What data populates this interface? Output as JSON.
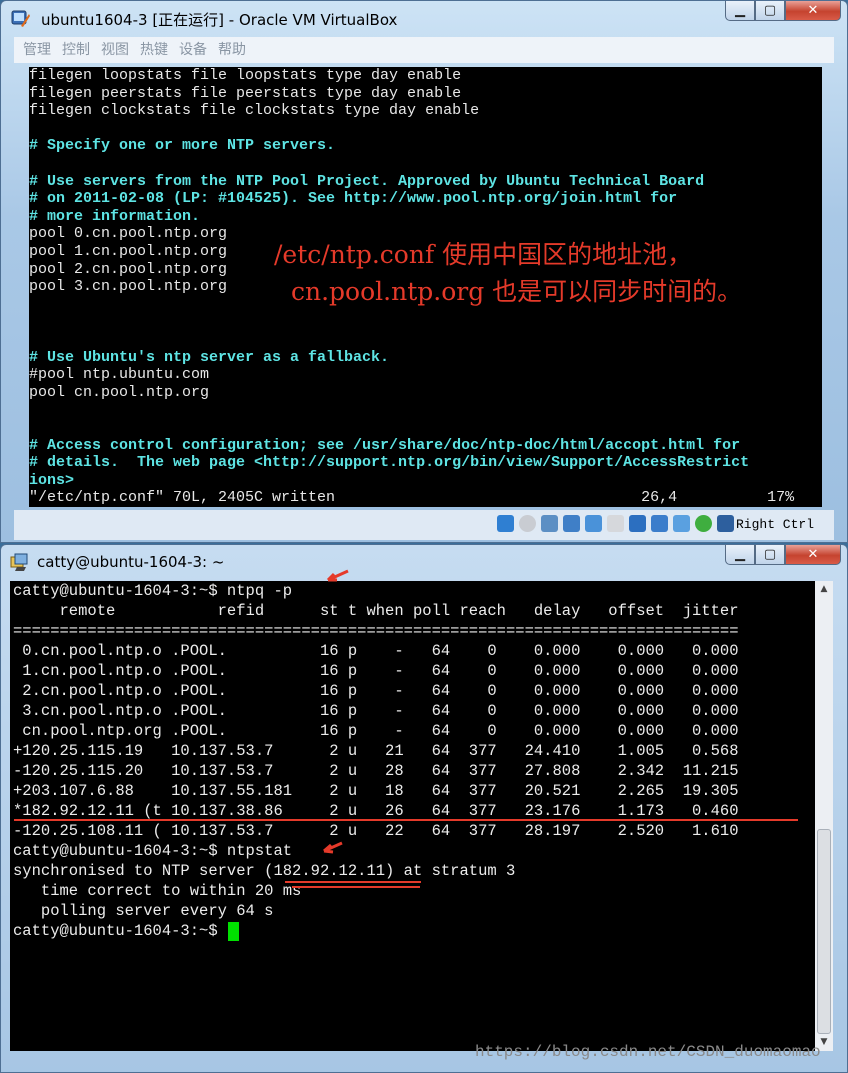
{
  "vbox_window": {
    "title": "ubuntu1604-3 [正在运行] - Oracle VM VirtualBox",
    "menu": [
      "管理",
      "控制",
      "视图",
      "热键",
      "设备",
      "帮助"
    ],
    "vim_lines": [
      {
        "t": "filegen loopstats file loopstats type day enable",
        "c": false
      },
      {
        "t": "filegen peerstats file peerstats type day enable",
        "c": false
      },
      {
        "t": "filegen clockstats file clockstats type day enable",
        "c": false
      },
      {
        "t": "",
        "c": false
      },
      {
        "t": "# Specify one or more NTP servers.",
        "c": true
      },
      {
        "t": "",
        "c": false
      },
      {
        "t": "# Use servers from the NTP Pool Project. Approved by Ubuntu Technical Board",
        "c": true
      },
      {
        "t": "# on 2011-02-08 (LP: #104525). See http://www.pool.ntp.org/join.html for",
        "c": true
      },
      {
        "t": "# more information.",
        "c": true
      },
      {
        "t": "pool 0.cn.pool.ntp.org",
        "c": false
      },
      {
        "t": "pool 1.cn.pool.ntp.org",
        "c": false
      },
      {
        "t": "pool 2.cn.pool.ntp.org",
        "c": false
      },
      {
        "t": "pool 3.cn.pool.ntp.org",
        "c": false
      },
      {
        "t": "",
        "c": false
      },
      {
        "t": "",
        "c": false
      },
      {
        "t": "",
        "c": false
      },
      {
        "t": "# Use Ubuntu's ntp server as a fallback.",
        "c": true
      },
      {
        "t": "#pool ntp.ubuntu.com",
        "c": false
      },
      {
        "t": "pool cn.pool.ntp.org",
        "c": false
      },
      {
        "t": "",
        "c": false
      },
      {
        "t": "",
        "c": false
      },
      {
        "t": "# Access control configuration; see /usr/share/doc/ntp-doc/html/accopt.html for",
        "c": true
      },
      {
        "t": "# details.  The web page <http://support.ntp.org/bin/view/Support/AccessRestrict",
        "c": true
      },
      {
        "t": "ions>",
        "c": true
      },
      {
        "t": "\"/etc/ntp.conf\" 70L, 2405C written                                  26,4          17%",
        "c": false
      }
    ],
    "annotation_line1": "/etc/ntp.conf 使用中国区的地址池，",
    "annotation_line2": "cn.pool.ntp.org 也是可以同步时间的。",
    "host_key": "Right Ctrl"
  },
  "terminal_window": {
    "title": "catty@ubuntu-1604-3: ~",
    "lines": [
      "catty@ubuntu-1604-3:~$ ntpq -p",
      "     remote           refid      st t when poll reach   delay   offset  jitter",
      "==============================================================================",
      " 0.cn.pool.ntp.o .POOL.          16 p    -   64    0    0.000    0.000   0.000",
      " 1.cn.pool.ntp.o .POOL.          16 p    -   64    0    0.000    0.000   0.000",
      " 2.cn.pool.ntp.o .POOL.          16 p    -   64    0    0.000    0.000   0.000",
      " 3.cn.pool.ntp.o .POOL.          16 p    -   64    0    0.000    0.000   0.000",
      " cn.pool.ntp.org .POOL.          16 p    -   64    0    0.000    0.000   0.000",
      "+120.25.115.19   10.137.53.7      2 u   21   64  377   24.410    1.005   0.568",
      "-120.25.115.20   10.137.53.7      2 u   28   64  377   27.808    2.342  11.215",
      "+203.107.6.88    10.137.55.181    2 u   18   64  377   20.521    2.265  19.305",
      "*182.92.12.11 (t 10.137.38.86     2 u   26   64  377   23.176    1.173   0.460",
      "-120.25.108.11 ( 10.137.53.7      2 u   22   64  377   28.197    2.520   1.610",
      "catty@ubuntu-1604-3:~$ ntpstat",
      "synchronised to NTP server (182.92.12.11) at stratum 3",
      "   time correct to within 20 ms",
      "   polling server every 64 s",
      "catty@ubuntu-1604-3:~$ "
    ]
  },
  "watermark": "https://blog.csdn.net/CSDN_duomaomao",
  "colors": {
    "comment": "#5ee4e4",
    "annotation": "#e53a2a",
    "cursor": "#00e000"
  }
}
